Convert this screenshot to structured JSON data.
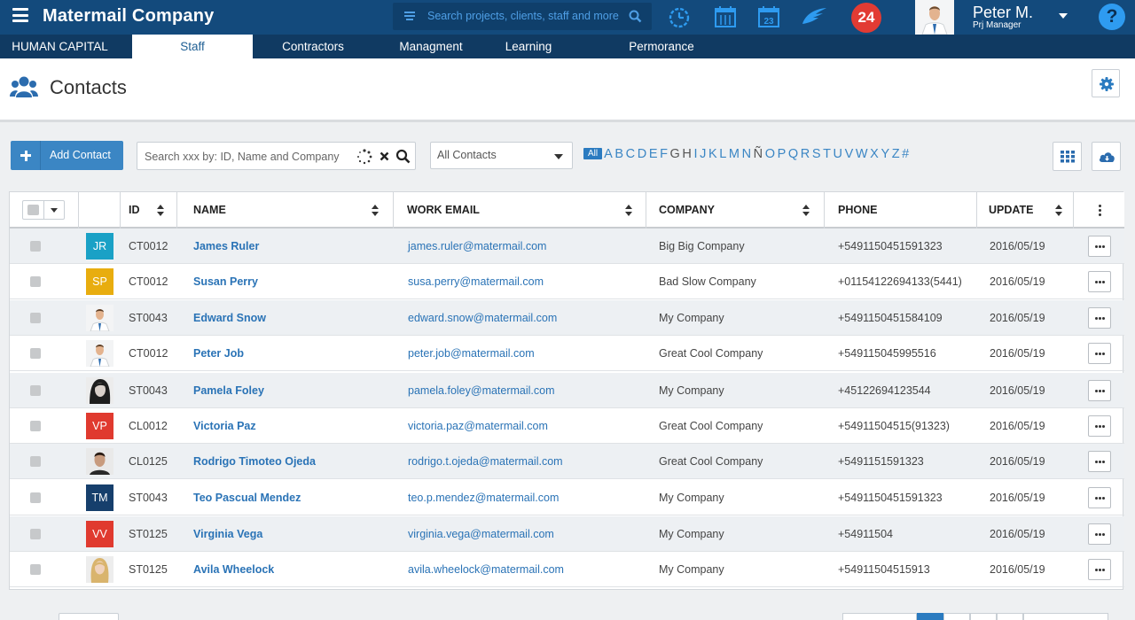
{
  "app": {
    "title": "Matermail Company",
    "search_placeholder": "Search projects, clients, staff and more",
    "notifications_count": "24",
    "user_name": "Peter M.",
    "user_role": "Prj Manager",
    "help": "?"
  },
  "nav": {
    "tabs": [
      "HUMAN CAPITAL",
      "Staff",
      "Contractors",
      "Managment",
      "Learning",
      "Permorance"
    ],
    "active": "Staff"
  },
  "page": {
    "title": "Contacts"
  },
  "toolbar": {
    "add_label": "Add Contact",
    "search_placeholder": "Search xxx by: ID, Name and Company",
    "filter_value": "All Contacts",
    "alpha_all": "All",
    "letters": [
      "A",
      "B",
      "C",
      "D",
      "E",
      "F",
      "G",
      "H",
      "I",
      "J",
      "K",
      "L",
      "M",
      "N",
      "Ñ",
      "O",
      "P",
      "Q",
      "R",
      "S",
      "T",
      "U",
      "V",
      "W",
      "X",
      "Y",
      "Z",
      "#"
    ]
  },
  "table": {
    "columns": [
      "ID",
      "NAME",
      "WORK EMAIL",
      "COMPANY",
      "PHONE",
      "UPDATE"
    ],
    "rows": [
      {
        "avatar": "JR",
        "avatar_color": "#1aa1c6",
        "id": "CT0012",
        "name": "James Ruler",
        "email": "james.ruler@matermail.com",
        "company": "Big Big Company",
        "phone": "+5491150451591323",
        "update": "2016/05/19"
      },
      {
        "avatar": "SP",
        "avatar_color": "#e8ad0f",
        "id": "CT0012",
        "name": "Susan Perry",
        "email": "susa.perry@matermail.com",
        "company": "Bad Slow Company",
        "phone": "+01154122694133(5441)",
        "update": "2016/05/19"
      },
      {
        "avatar": "photo-man-tie",
        "avatar_color": "",
        "id": "ST0043",
        "name": "Edward Snow",
        "email": "edward.snow@matermail.com",
        "company": "My Company",
        "phone": "+5491150451584109",
        "update": "2016/05/19"
      },
      {
        "avatar": "photo-man-tie",
        "avatar_color": "",
        "id": "CT0012",
        "name": "Peter Job",
        "email": "peter.job@matermail.com",
        "company": "Great Cool Company",
        "phone": "+549115045995516",
        "update": "2016/05/19"
      },
      {
        "avatar": "photo-woman-dark",
        "avatar_color": "",
        "id": "ST0043",
        "name": "Pamela Foley",
        "email": "pamela.foley@matermail.com",
        "company": "My Company",
        "phone": "+45122694123544",
        "update": "2016/05/19"
      },
      {
        "avatar": "VP",
        "avatar_color": "#e03a2f",
        "id": "CL0012",
        "name": "Victoria Paz",
        "email": "victoria.paz@matermail.com",
        "company": "Great Cool Company",
        "phone": "+54911504515(91323)",
        "update": "2016/05/19"
      },
      {
        "avatar": "photo-man-dark",
        "avatar_color": "",
        "id": "CL0125",
        "name": "Rodrigo Timoteo Ojeda",
        "email": "rodrigo.t.ojeda@matermail.com",
        "company": "Great Cool Company",
        "phone": "+5491151591323",
        "update": "2016/05/19"
      },
      {
        "avatar": "TM",
        "avatar_color": "#163f6c",
        "id": "ST0043",
        "name": "Teo Pascual Mendez",
        "email": "teo.p.mendez@matermail.com",
        "company": "My Company",
        "phone": "+5491150451591323",
        "update": "2016/05/19"
      },
      {
        "avatar": "VV",
        "avatar_color": "#e03a2f",
        "id": "ST0125",
        "name": "Virginia Vega",
        "email": "virginia.vega@matermail.com",
        "company": "My Company",
        "phone": "+54911504",
        "update": "2016/05/19"
      },
      {
        "avatar": "photo-woman-blonde",
        "avatar_color": "",
        "id": "ST0125",
        "name": "Avila Wheelock",
        "email": "avila.wheelock@matermail.com",
        "company": "My Company",
        "phone": "+54911504515913",
        "update": "2016/05/19"
      }
    ]
  },
  "icons": {
    "menu": "menu-icon",
    "search": "search-icon",
    "clock": "clock-icon",
    "calendar": "calendar-icon",
    "calendar_day": "calendar-23-icon",
    "wing": "wing-icon",
    "help": "help-icon",
    "contacts": "users-icon",
    "settings": "gear-icon",
    "grid": "grid-icon",
    "cloud": "cloud-download-icon",
    "clear": "clear-icon",
    "loading": "loading-icon",
    "more": "more-icon",
    "columns": "kebab-icon"
  },
  "colors": {
    "topbar": "#134a7c",
    "nav": "#103a62",
    "accent": "#3b86c4",
    "link": "#2a73b6"
  }
}
